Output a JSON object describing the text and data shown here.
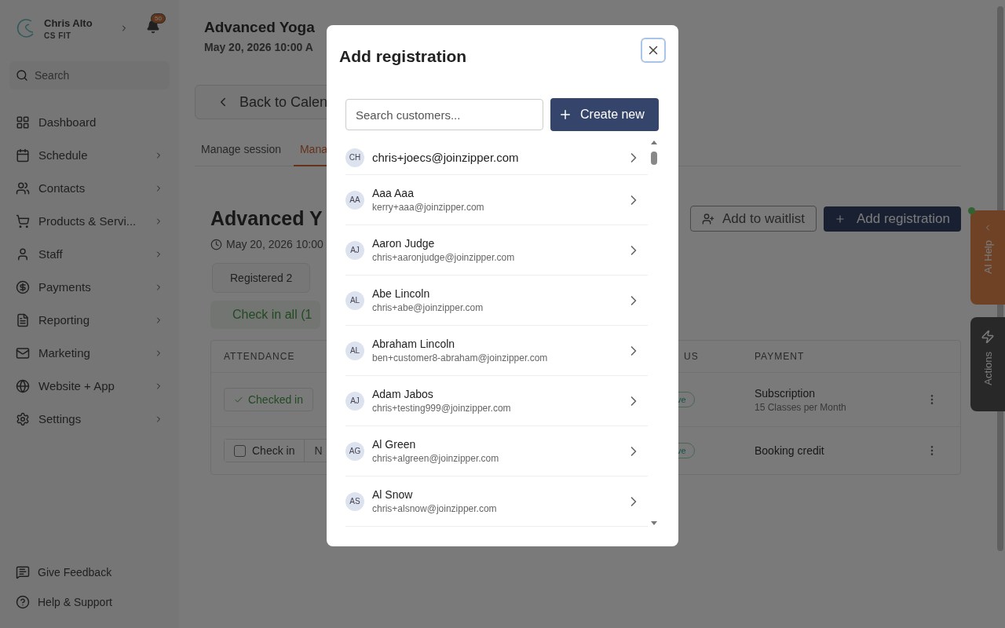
{
  "account": {
    "name": "Chris Alto",
    "business": "CS FIT",
    "notifications": "50"
  },
  "sidebar": {
    "search_placeholder": "Search",
    "items": [
      {
        "label": "Dashboard",
        "has_submenu": false
      },
      {
        "label": "Schedule",
        "has_submenu": true
      },
      {
        "label": "Contacts",
        "has_submenu": true
      },
      {
        "label": "Products & Servi...",
        "has_submenu": true
      },
      {
        "label": "Staff",
        "has_submenu": true
      },
      {
        "label": "Payments",
        "has_submenu": true
      },
      {
        "label": "Reporting",
        "has_submenu": true
      },
      {
        "label": "Marketing",
        "has_submenu": true
      },
      {
        "label": "Website + App",
        "has_submenu": true
      },
      {
        "label": "Settings",
        "has_submenu": true
      }
    ],
    "footer": [
      "Give Feedback",
      "Help & Support"
    ]
  },
  "header": {
    "title": "Advanced Yoga",
    "date": "May 20, 2026 10:00 A",
    "back": "Back to Calen"
  },
  "tabs": [
    {
      "label": "Manage session",
      "selected": false
    },
    {
      "label": "Mana",
      "selected": true
    }
  ],
  "session": {
    "title": "Advanced Y",
    "date": "May 20, 2026 10:00",
    "filter": "Registered 2",
    "check_all": "Check in all (1",
    "waitlist": "Add to waitlist",
    "add": "Add registration"
  },
  "table": {
    "columns": [
      "ATTENDANCE",
      "US",
      "PAYMENT"
    ],
    "rows": [
      {
        "attendance": "Checked in",
        "checked": true,
        "status": "ve",
        "payment": "Subscription",
        "payment_detail": "15 Classes per Month"
      },
      {
        "attendance": "Check in",
        "checked": false,
        "other": "N",
        "status": "ve",
        "payment": "Booking credit"
      }
    ]
  },
  "side_tabs": [
    {
      "label": "AI Help",
      "kind": "help"
    },
    {
      "label": "Actions",
      "kind": "actions"
    }
  ],
  "modal": {
    "title": "Add registration",
    "search_placeholder": "Search customers...",
    "create": "Create new",
    "customers": [
      {
        "initials": "CH",
        "name": "chris+joecs@joinzipper.com"
      },
      {
        "initials": "AA",
        "name": "Aaa Aaa",
        "email": "kerry+aaa@joinzipper.com"
      },
      {
        "initials": "AJ",
        "name": "Aaron Judge",
        "email": "chris+aaronjudge@joinzipper.com"
      },
      {
        "initials": "AL",
        "name": "Abe Lincoln",
        "email": "chris+abe@joinzipper.com"
      },
      {
        "initials": "AL",
        "name": "Abraham Lincoln",
        "email": "ben+customer8-abraham@joinzipper.com"
      },
      {
        "initials": "AJ",
        "name": "Adam Jabos",
        "email": "chris+testing999@joinzipper.com"
      },
      {
        "initials": "AG",
        "name": "Al Green",
        "email": "chris+algreen@joinzipper.com"
      },
      {
        "initials": "AS",
        "name": "Al Snow",
        "email": "chris+alsnow@joinzipper.com"
      }
    ]
  }
}
